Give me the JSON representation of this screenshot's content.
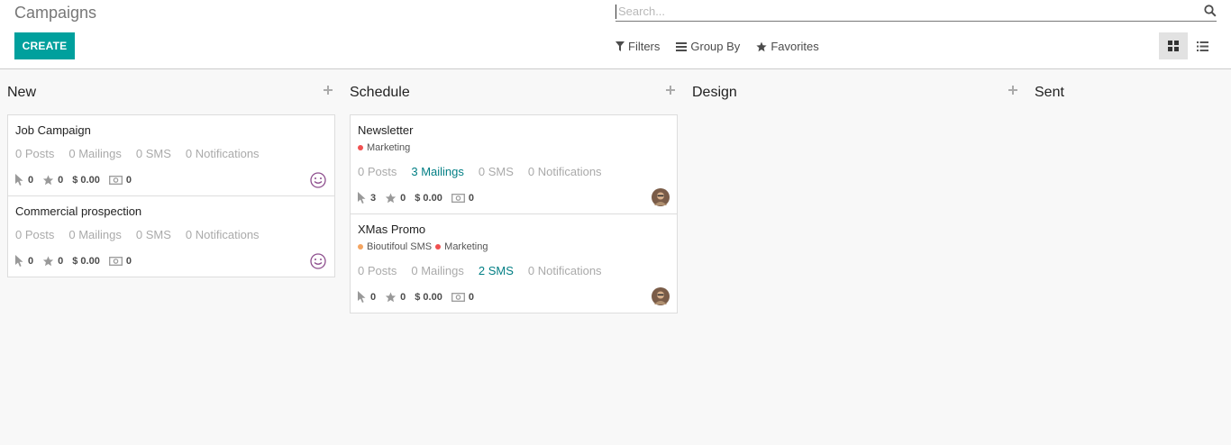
{
  "page": {
    "title": "Campaigns"
  },
  "toolbar": {
    "create_label": "CREATE"
  },
  "search": {
    "placeholder": "Search..."
  },
  "filters": {
    "filters_label": "Filters",
    "groupby_label": "Group By",
    "favorites_label": "Favorites"
  },
  "views": {
    "active": "kanban",
    "options": [
      "kanban",
      "list"
    ]
  },
  "columns": [
    {
      "title": "New"
    },
    {
      "title": "Schedule"
    },
    {
      "title": "Design"
    },
    {
      "title": "Sent"
    }
  ],
  "cards": {
    "job": {
      "title": "Job Campaign",
      "posts": "0 Posts",
      "mailings": "0 Mailings",
      "sms": "0 SMS",
      "notifications": "0 Notifications",
      "clicks": "0",
      "stars": "0",
      "revenue": "$ 0.00",
      "cash": "0",
      "avatar": "smiley-icon"
    },
    "commercial": {
      "title": "Commercial prospection",
      "posts": "0 Posts",
      "mailings": "0 Mailings",
      "sms": "0 SMS",
      "notifications": "0 Notifications",
      "clicks": "0",
      "stars": "0",
      "revenue": "$ 0.00",
      "cash": "0",
      "avatar": "smiley-icon"
    },
    "newsletter": {
      "title": "Newsletter",
      "tags": [
        {
          "label": "Marketing",
          "color": "#f05050"
        }
      ],
      "posts": "0 Posts",
      "mailings": "3 Mailings",
      "sms": "0 SMS",
      "notifications": "0 Notifications",
      "clicks": "3",
      "stars": "0",
      "revenue": "$ 0.00",
      "cash": "0",
      "avatar": "user-photo"
    },
    "xmas": {
      "title": "XMas Promo",
      "tags": [
        {
          "label": "Bioutifoul SMS",
          "color": "#f4a460"
        },
        {
          "label": "Marketing",
          "color": "#f05050"
        }
      ],
      "posts": "0 Posts",
      "mailings": "0 Mailings",
      "sms": "2 SMS",
      "notifications": "0 Notifications",
      "clicks": "0",
      "stars": "0",
      "revenue": "$ 0.00",
      "cash": "0",
      "avatar": "user-photo"
    }
  },
  "colors": {
    "accent": "#00a09d",
    "highlight": "#017e84",
    "smiley": "#8e4f8e"
  }
}
